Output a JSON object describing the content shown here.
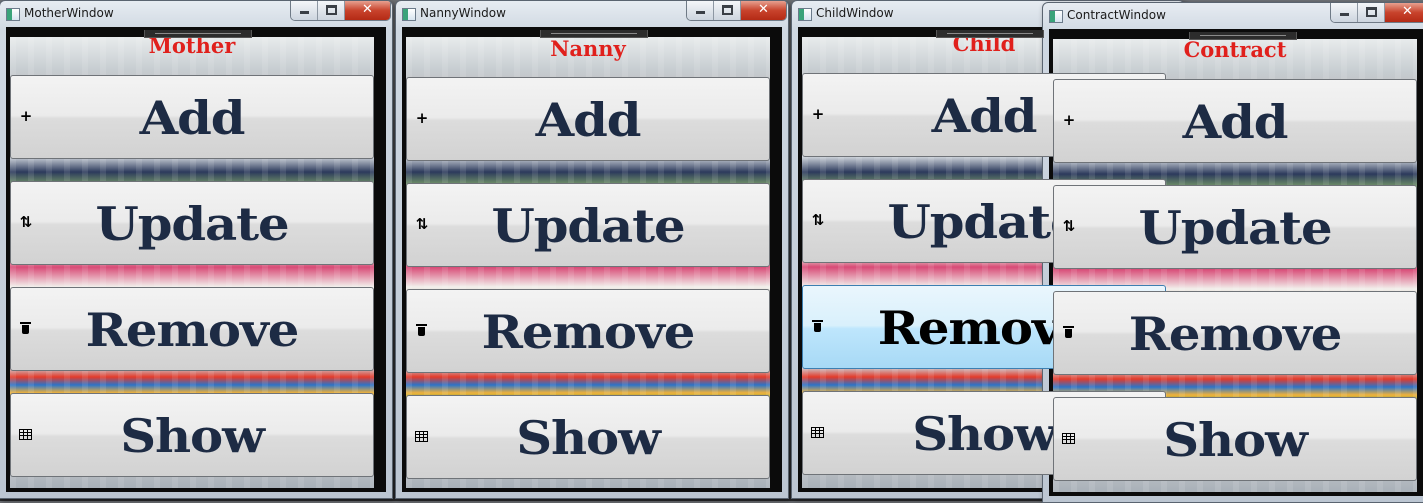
{
  "windows": [
    {
      "title": "MotherWindow",
      "header": "Mother",
      "buttons": {
        "add": "Add",
        "update": "Update",
        "remove": "Remove",
        "show": "Show"
      }
    },
    {
      "title": "NannyWindow",
      "header": "Nanny",
      "buttons": {
        "add": "Add",
        "update": "Update",
        "remove": "Remove",
        "show": "Show"
      }
    },
    {
      "title": "ChildWindow",
      "header": "Child",
      "buttons": {
        "add": "Add",
        "update": "Update",
        "remove": "Remove",
        "show": "Show"
      },
      "hovered_button": "remove"
    },
    {
      "title": "ContractWindow",
      "header": "Contract",
      "buttons": {
        "add": "Add",
        "update": "Update",
        "remove": "Remove",
        "show": "Show"
      }
    }
  ],
  "icons": {
    "add": "plus-icon",
    "update": "refresh-icon",
    "remove": "trash-icon",
    "show": "table-icon"
  },
  "colors": {
    "header_text": "#e0201c",
    "button_text": "#1d2b44",
    "hover_button": "#bee6fd",
    "close_button": "#c8432c"
  }
}
